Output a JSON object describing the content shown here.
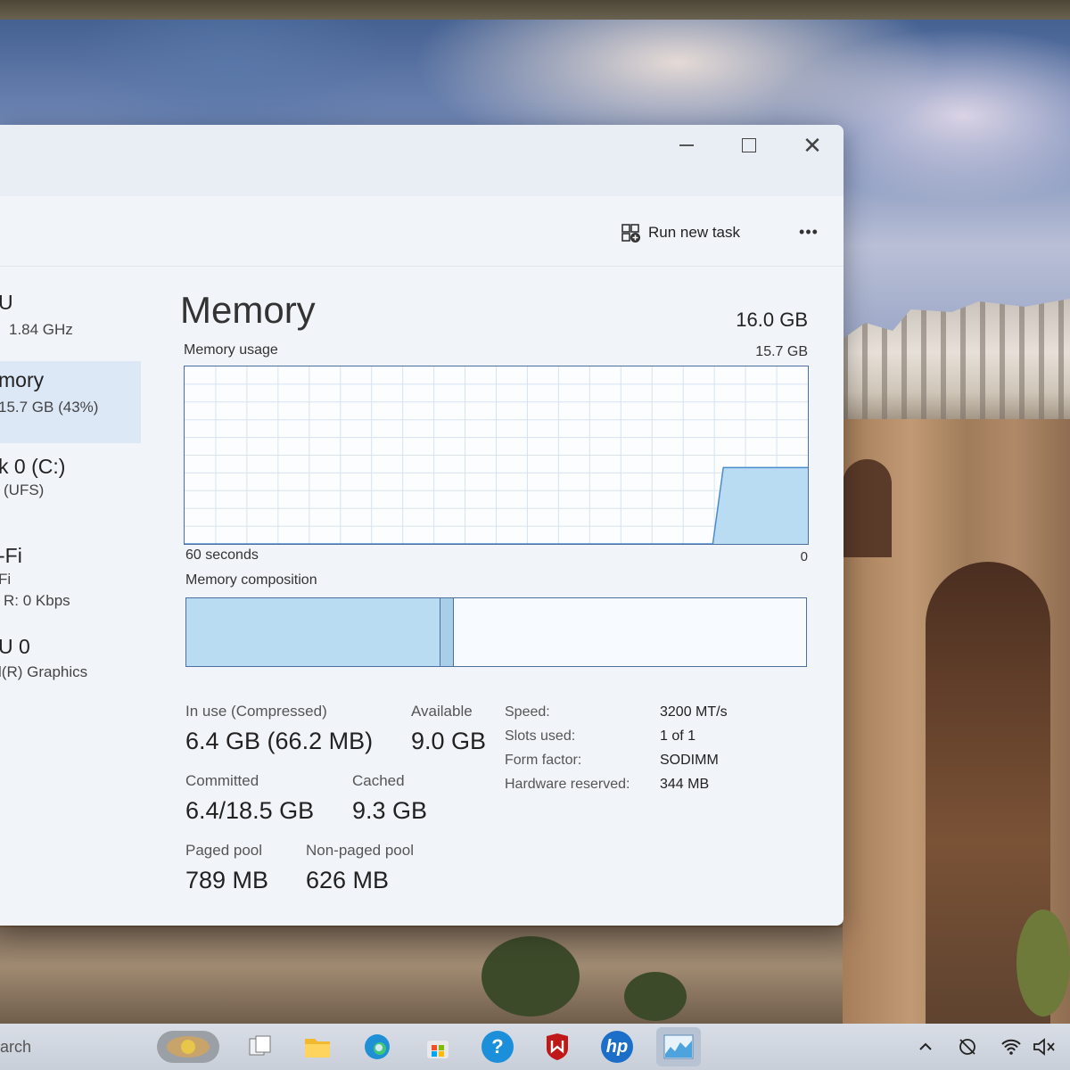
{
  "window": {
    "minimize_glyph": "",
    "close_glyph": "✕"
  },
  "commandbar": {
    "run_task_label": "Run new task",
    "more_label": "•••"
  },
  "sidebar": {
    "items": [
      {
        "title": "U",
        "subtitle": "1.84 GHz",
        "selected": false
      },
      {
        "title": "mory",
        "subtitle": "15.7 GB (43%)",
        "selected": true
      },
      {
        "title": "k 0 (C:)",
        "subtitle": "(UFS)",
        "selected": false
      },
      {
        "title": "-Fi",
        "subtitle": "Fi",
        "detail": "R: 0 Kbps",
        "selected": false
      },
      {
        "title": "U 0",
        "subtitle": "l(R) Graphics",
        "selected": false
      }
    ]
  },
  "main": {
    "title": "Memory",
    "total": "16.0 GB",
    "usage_label": "Memory usage",
    "usage_max": "15.7 GB",
    "axis_left": "60 seconds",
    "axis_right": "0",
    "composition_label": "Memory composition",
    "usage_history_fraction": [
      0,
      0,
      0,
      0,
      0,
      0,
      0,
      0,
      0,
      0,
      0,
      0,
      0,
      0,
      0,
      0,
      0,
      0,
      0,
      0,
      0,
      0,
      0,
      0,
      0,
      0,
      0,
      0,
      0,
      0,
      0,
      0,
      0,
      0,
      0,
      0,
      0,
      0,
      0,
      0,
      0,
      0,
      0,
      0,
      0,
      0,
      0,
      0,
      0,
      0,
      0,
      0.43,
      0.43,
      0.43,
      0.43,
      0.43,
      0.43,
      0.43,
      0.43,
      0.43
    ],
    "composition_fractions": {
      "in_use": 0.41,
      "modified": 0.02,
      "standby_free": 0.57
    },
    "stats": {
      "in_use_label": "In use (Compressed)",
      "in_use_value": "6.4 GB (66.2 MB)",
      "available_label": "Available",
      "available_value": "9.0 GB",
      "committed_label": "Committed",
      "committed_value": "6.4/18.5 GB",
      "cached_label": "Cached",
      "cached_value": "9.3 GB",
      "paged_label": "Paged pool",
      "paged_value": "789 MB",
      "nonpaged_label": "Non-paged pool",
      "nonpaged_value": "626 MB"
    },
    "specs": [
      {
        "key": "Speed:",
        "value": "3200 MT/s"
      },
      {
        "key": "Slots used:",
        "value": "1 of 1"
      },
      {
        "key": "Form factor:",
        "value": "SODIMM"
      },
      {
        "key": "Hardware reserved:",
        "value": "344 MB"
      }
    ]
  },
  "taskbar": {
    "search_text": "arch",
    "apps": [
      "widgets-icon",
      "task-view-icon",
      "file-explorer-icon",
      "edge-icon",
      "store-icon",
      "help-icon",
      "mcafee-icon",
      "hp-icon",
      "task-manager-icon"
    ],
    "tray": [
      "chevron-up-icon",
      "location-off-icon",
      "wifi-icon",
      "speaker-muted-icon"
    ],
    "help_glyph": "?",
    "hp_glyph": "hp"
  },
  "colors": {
    "graph_fill": "#b9dcf2",
    "graph_stroke": "#4b8ccc",
    "grid": "#d7e3ef",
    "border": "#4b6f9e"
  }
}
